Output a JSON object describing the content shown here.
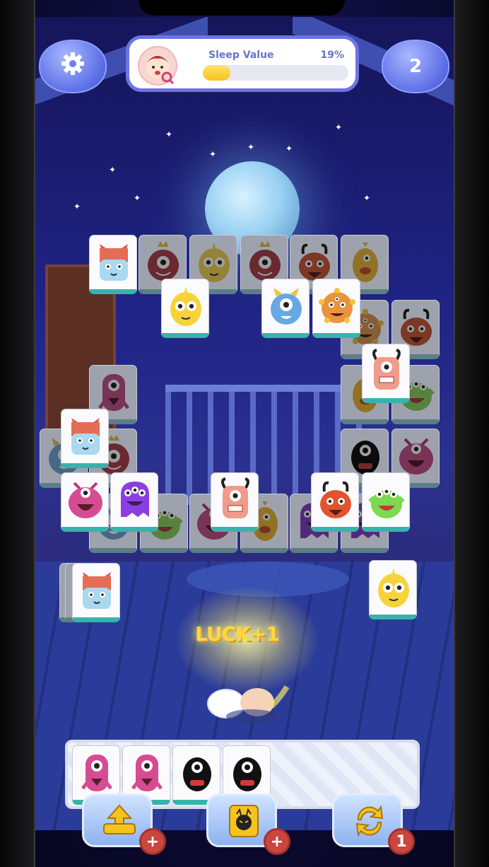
{
  "hud": {
    "settings_icon": "gear-icon",
    "sleep_label": "Sleep Value",
    "sleep_percent": "19%",
    "sleep_fraction": 0.19,
    "avatar_icon": "baby-avatar-icon",
    "count": "2"
  },
  "effect": {
    "luck_text": "LUCK+1"
  },
  "boosters": [
    {
      "name": "undo-booster",
      "icon": "arrow-up-icon",
      "badge": "+"
    },
    {
      "name": "hint-booster",
      "icon": "devil-icon",
      "badge": "+"
    },
    {
      "name": "shuffle-booster",
      "icon": "shuffle-icon",
      "badge": "1"
    }
  ],
  "colors": {
    "accent": "#6d74e4",
    "tile_edge": "#38b3ac",
    "badge": "#c9473f",
    "bar_fill": "#f6c21e"
  }
}
